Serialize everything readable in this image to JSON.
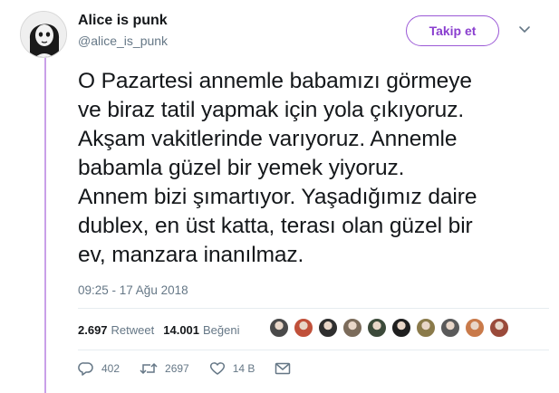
{
  "user": {
    "display_name": "Alice is punk",
    "handle": "@alice_is_punk"
  },
  "follow_button": {
    "label": "Takip et"
  },
  "tweet": {
    "lines": [
      "O Pazartesi annemle babamızı görmeye",
      "ve biraz tatil yapmak için yola çıkıyoruz.",
      "Akşam vakitlerinde varıyoruz. Annemle",
      "babamla güzel bir yemek yiyoruz.",
      "Annem bizi şımartıyor. Yaşadığımız daire",
      "dublex, en üst katta, terası olan güzel bir",
      "ev, manzara inanılmaz."
    ],
    "timestamp": "09:25 - 17 Ağu 2018"
  },
  "stats": {
    "retweet_count": "2.697",
    "retweet_label": "Retweet",
    "like_count": "14.001",
    "like_label": "Beğeni"
  },
  "likers": [
    {
      "icon": "liker-avatar",
      "color": "#4a4a4a"
    },
    {
      "icon": "liker-avatar",
      "color": "#c0503a"
    },
    {
      "icon": "liker-avatar",
      "color": "#2f2f2f"
    },
    {
      "icon": "liker-avatar",
      "color": "#7b6b5a"
    },
    {
      "icon": "liker-avatar",
      "color": "#3c4a3a"
    },
    {
      "icon": "liker-avatar",
      "color": "#1f1f1f"
    },
    {
      "icon": "liker-avatar",
      "color": "#8a7a4a"
    },
    {
      "icon": "liker-avatar",
      "color": "#5a5a5a"
    },
    {
      "icon": "liker-avatar",
      "color": "#c97a4a"
    },
    {
      "icon": "liker-avatar",
      "color": "#9a4a3a"
    }
  ],
  "actions": {
    "reply_count": "402",
    "retweet_count": "2697",
    "like_count": "14 B"
  },
  "colors": {
    "accent": "#9b59d6",
    "thread_line": "#c9a0e8",
    "secondary_text": "#657786"
  }
}
